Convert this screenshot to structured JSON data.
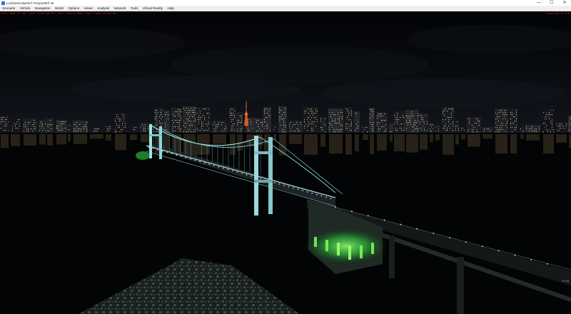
{
  "window": {
    "title": "Lockheed Martin® Prepar3D® v5",
    "controls": {
      "minimize": "—",
      "maximize": "☐",
      "close": "✕"
    }
  },
  "menu": {
    "items": [
      "Scenario",
      "Vehicle",
      "Navigation",
      "World",
      "Options",
      "Views",
      "Analysis",
      "Network",
      "Tools",
      "Virtual Reality",
      "Help"
    ]
  },
  "hud": {
    "left": "LAT: N35°37.59' LON: E139°46.04' ALT: 156 m  HDG: 316°  Time 20:59:00",
    "right": "Internal 0 fps"
  },
  "corner_label": "DLVR",
  "colors": {
    "hud_text": "#e02020",
    "titlebar_bg": "#ffffff",
    "menubar_bg": "#f0f0f0",
    "bridge_cyan": "#9fe4e8",
    "pier_green": "#35e04a"
  },
  "icons": {
    "app": "p3d-app-icon"
  }
}
